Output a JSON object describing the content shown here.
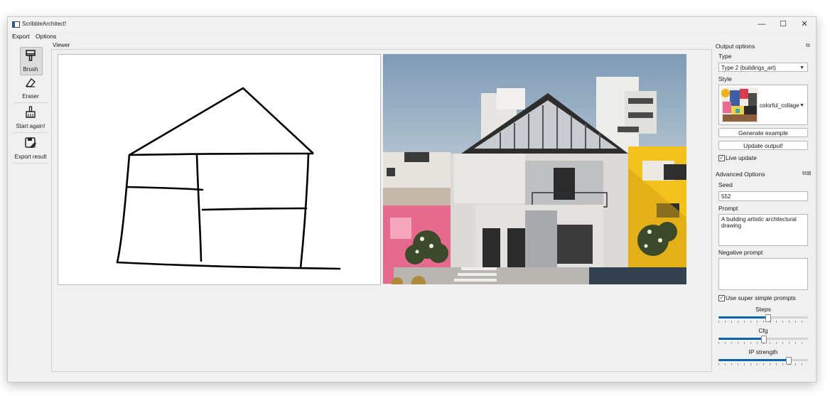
{
  "window": {
    "title": "ScribbleArchitect!"
  },
  "menu": {
    "export": "Export",
    "options": "Options"
  },
  "controls": {
    "minimize": "—",
    "maximize": "☐",
    "close": "✕"
  },
  "toolbar": {
    "brush": "Brush",
    "eraser": "Eraser",
    "start_again": "Start again!",
    "export_result": "Export result"
  },
  "viewer": {
    "label": "Viewer"
  },
  "output_options": {
    "title": "Output options",
    "type_label": "Type",
    "type_value": "Type 2 (buildings_art)",
    "style_label": "Style",
    "style_value": "colorful_collage",
    "generate_example": "Generate example",
    "update_output": "Update output!",
    "live_update": "Live update",
    "live_update_checked": true
  },
  "advanced_options": {
    "title": "Advanced Options",
    "seed_label": "Seed",
    "seed_value": "552",
    "prompt_label": "Prompt",
    "prompt_value": "A building artistic architectural drawing",
    "negative_prompt_label": "Negative prompt",
    "negative_prompt_value": "",
    "simple_prompts": "Use super simple prompts",
    "simple_prompts_checked": true,
    "steps_label": "Steps",
    "steps_level": 0.55,
    "cfg_label": "Cfg",
    "cfg_level": 0.5,
    "ip_strength_label": "IP strength",
    "ip_strength_level": 0.78
  }
}
